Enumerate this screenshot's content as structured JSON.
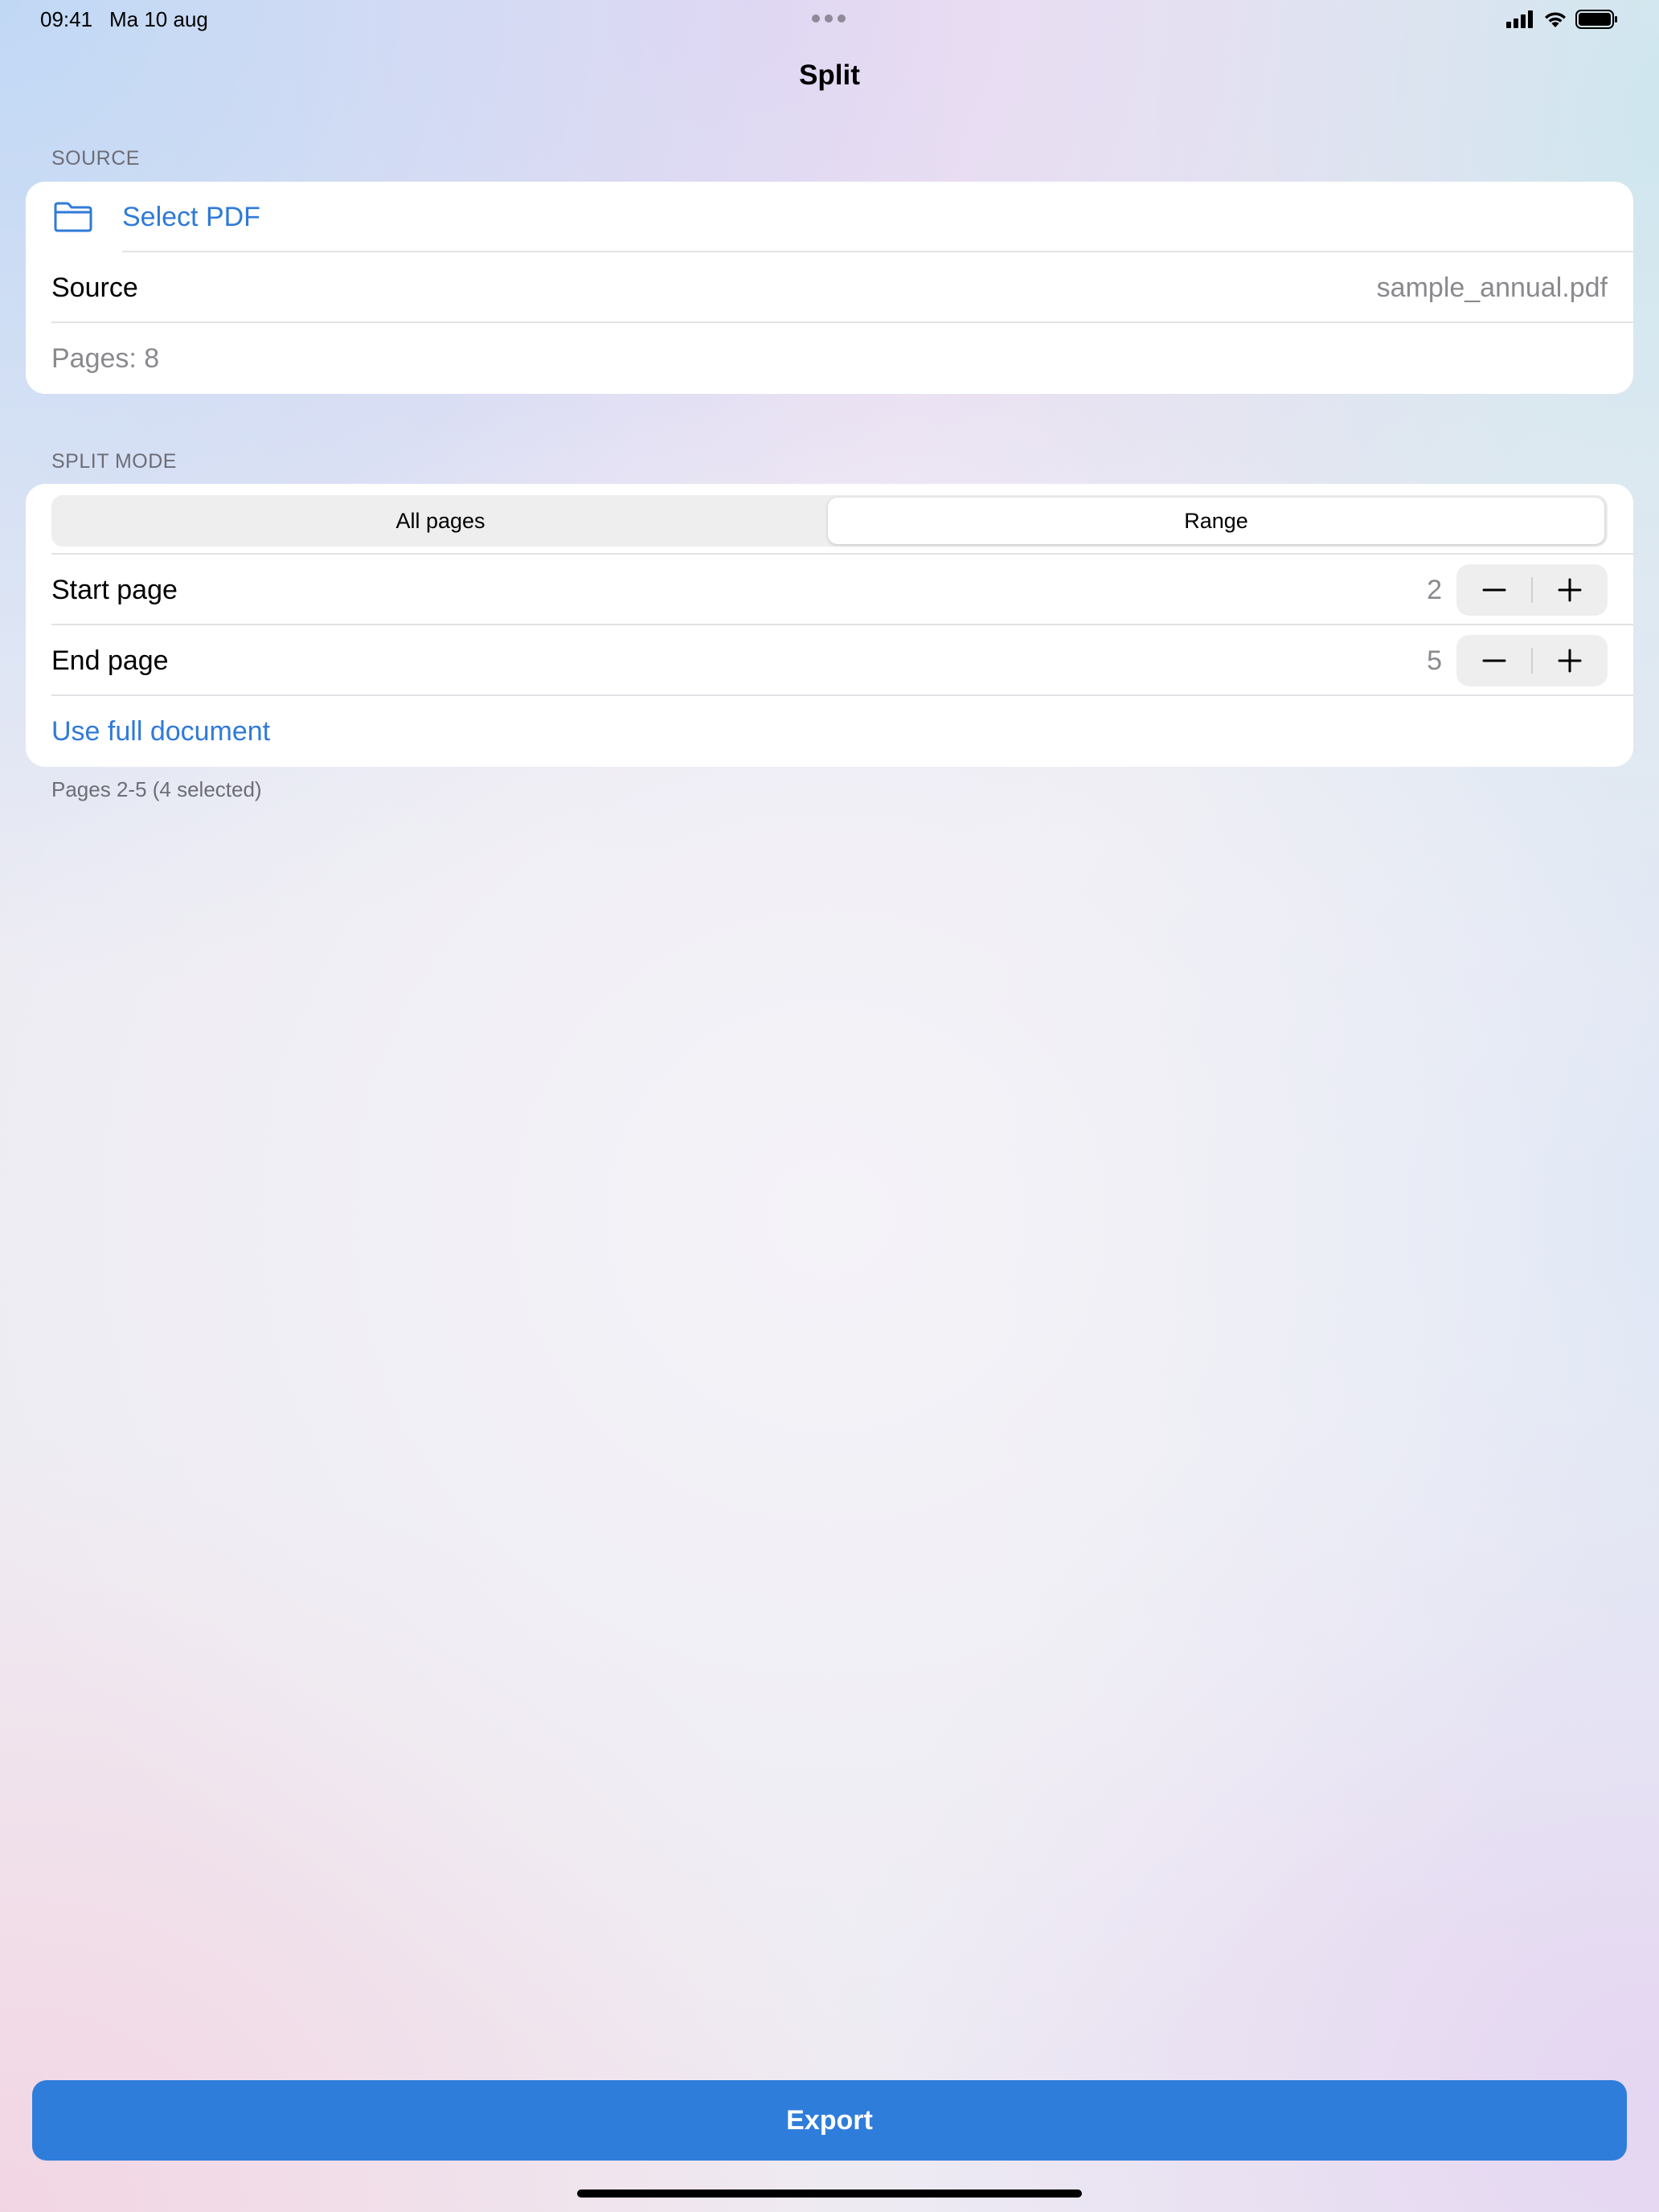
{
  "status_bar": {
    "time": "09:41",
    "date": "Ma 10 aug"
  },
  "nav": {
    "title": "Split"
  },
  "source_section": {
    "header": "SOURCE",
    "select_label": "Select PDF",
    "source_label": "Source",
    "source_value": "sample_annual.pdf",
    "pages_text": "Pages: 8"
  },
  "split_section": {
    "header": "SPLIT MODE",
    "modes": [
      {
        "label": "All pages",
        "selected": false
      },
      {
        "label": "Range",
        "selected": true
      }
    ],
    "start_label": "Start page",
    "start_value": "2",
    "end_label": "End page",
    "end_value": "5",
    "full_doc_label": "Use full document",
    "summary": "Pages 2-5 (4 selected)"
  },
  "actions": {
    "export_label": "Export"
  },
  "colors": {
    "accent": "#2f7ddb",
    "link": "#2f7ad8",
    "muted": "#8a8a8e"
  },
  "icons": {
    "select": "folder-icon",
    "decrement": "minus-icon",
    "increment": "plus-icon"
  }
}
